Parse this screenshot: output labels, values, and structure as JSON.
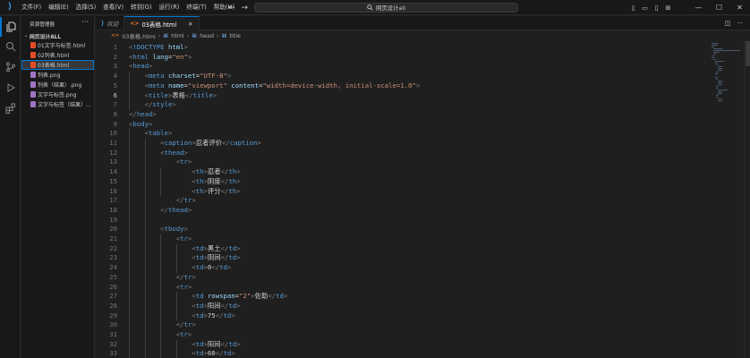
{
  "menu": [
    "文件(F)",
    "编辑(E)",
    "选择(S)",
    "查看(V)",
    "转到(G)",
    "运行(R)",
    "终端(T)",
    "帮助(H)"
  ],
  "search": {
    "text": "网页设计all"
  },
  "sidebar": {
    "title": "资源管理器",
    "folder": "网页设计ALL",
    "items": [
      {
        "label": "01文字与标签.html",
        "type": "html"
      },
      {
        "label": "02列表.html",
        "type": "html"
      },
      {
        "label": "03表格.html",
        "type": "html",
        "selected": true
      },
      {
        "label": "列表.png",
        "type": "img"
      },
      {
        "label": "列表（结果）.png",
        "type": "img"
      },
      {
        "label": "文字与标签.png",
        "type": "img"
      },
      {
        "label": "文字与标签（结果）...",
        "type": "img"
      }
    ]
  },
  "tabs": [
    {
      "label": "欢迎",
      "icon": "vscode-icon",
      "active": false
    },
    {
      "label": "03表格.html",
      "icon": "html-icon",
      "active": true
    }
  ],
  "breadcrumb": [
    "03表格.html",
    "html",
    "head",
    "title"
  ],
  "editor": {
    "current_line": 6,
    "lines": [
      {
        "n": "1",
        "code": "<!DOCTYPE html>"
      },
      {
        "n": "2",
        "code": "<html lang=\"en\">"
      },
      {
        "n": "3",
        "code": "<head>"
      },
      {
        "n": "4",
        "code": "    <meta charset=\"UTF-8\">"
      },
      {
        "n": "5",
        "code": "    <meta name=\"viewport\" content=\"width=device-width, initial-scale=1.0\">"
      },
      {
        "n": "6",
        "code": "    <title>表格</title>"
      },
      {
        "n": "7",
        "code": "    </style>"
      },
      {
        "n": "8",
        "code": "</head>"
      },
      {
        "n": "9",
        "code": "<body>"
      },
      {
        "n": "10",
        "code": "    <table>"
      },
      {
        "n": "11",
        "code": "        <caption>忍者评价</caption>"
      },
      {
        "n": "12",
        "code": "        <thead>"
      },
      {
        "n": "13",
        "code": "            <tr>"
      },
      {
        "n": "14",
        "code": "                <th>忍者</th>"
      },
      {
        "n": "15",
        "code": "                <th>阴度</th>"
      },
      {
        "n": "16",
        "code": "                <th>评分</th>"
      },
      {
        "n": "17",
        "code": "            </tr>"
      },
      {
        "n": "18",
        "code": "        </thead>"
      },
      {
        "n": "19",
        "code": ""
      },
      {
        "n": "20",
        "code": "        <tbody>"
      },
      {
        "n": "21",
        "code": "            <tr>"
      },
      {
        "n": "22",
        "code": "                <td>黑土</td>"
      },
      {
        "n": "23",
        "code": "                <td>阴间</td>"
      },
      {
        "n": "24",
        "code": "                <td>0</td>"
      },
      {
        "n": "25",
        "code": "            </tr>"
      },
      {
        "n": "26",
        "code": "            <tr>"
      },
      {
        "n": "27",
        "code": "                <td rowspan=\"2\">佐助</td>"
      },
      {
        "n": "28",
        "code": "                <td>阳间</td>"
      },
      {
        "n": "29",
        "code": "                <td>75</td>"
      },
      {
        "n": "30",
        "code": "            </tr>"
      },
      {
        "n": "31",
        "code": "            <tr>"
      },
      {
        "n": "32",
        "code": "                <td>阳间</td>"
      },
      {
        "n": "33",
        "code": "                <td>60</td>"
      }
    ]
  },
  "colors": {
    "accent": "#0078d4",
    "tag": "#569cd6",
    "attr": "#9cdcfe",
    "string": "#ce9178",
    "text": "#d4d4d4",
    "bracket": "#808080"
  }
}
